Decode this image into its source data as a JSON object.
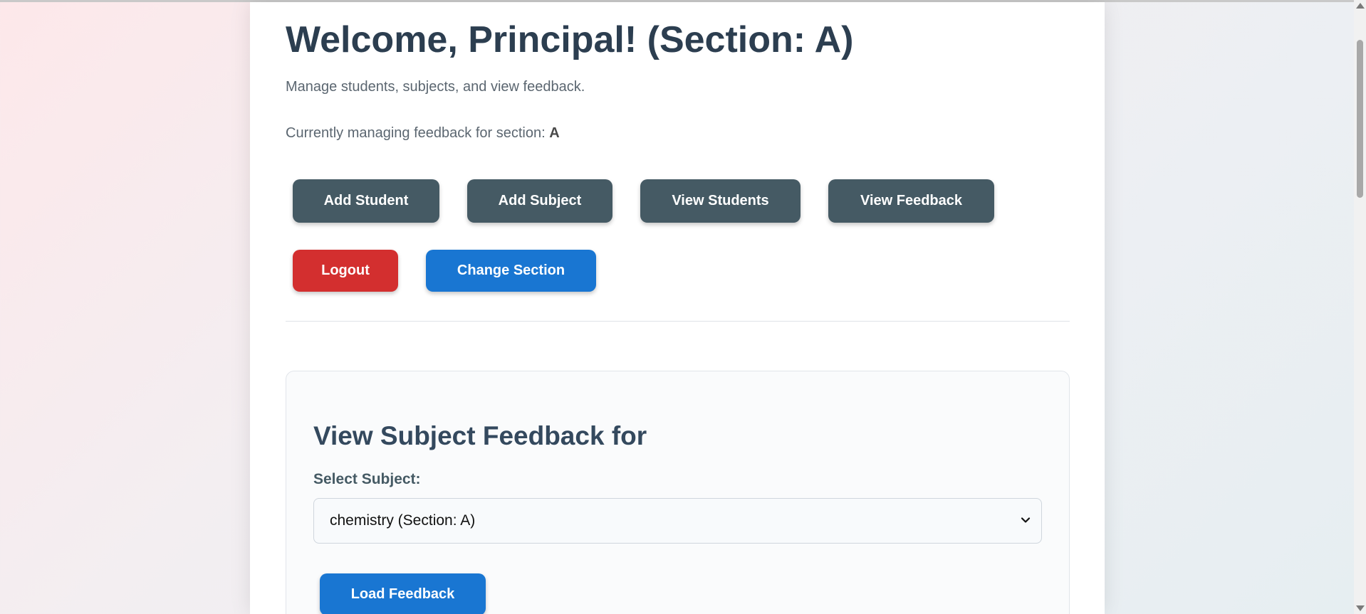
{
  "header": {
    "title": "Welcome, Principal! (Section: A)",
    "subtitle": "Manage students, subjects, and view feedback.",
    "section_note_prefix": "Currently managing feedback for section:",
    "section_value": "A"
  },
  "actions": {
    "add_student": "Add Student",
    "add_subject": "Add Subject",
    "view_students": "View Students",
    "view_feedback": "View Feedback",
    "logout": "Logout",
    "change_section": "Change Section"
  },
  "feedback_panel": {
    "title": "View Subject Feedback for",
    "select_label": "Select Subject:",
    "selected_subject": "chemistry (Section: A)",
    "load_button": "Load Feedback"
  },
  "colors": {
    "primary_blue": "#1976d2",
    "dark_slate": "#455a64",
    "danger_red": "#d32f2f",
    "heading": "#2c3e50"
  },
  "icons": {
    "select_chevron": "chevron-down-icon",
    "scroll_up": "scroll-up-arrow-icon",
    "scroll_down": "scroll-down-arrow-icon"
  }
}
